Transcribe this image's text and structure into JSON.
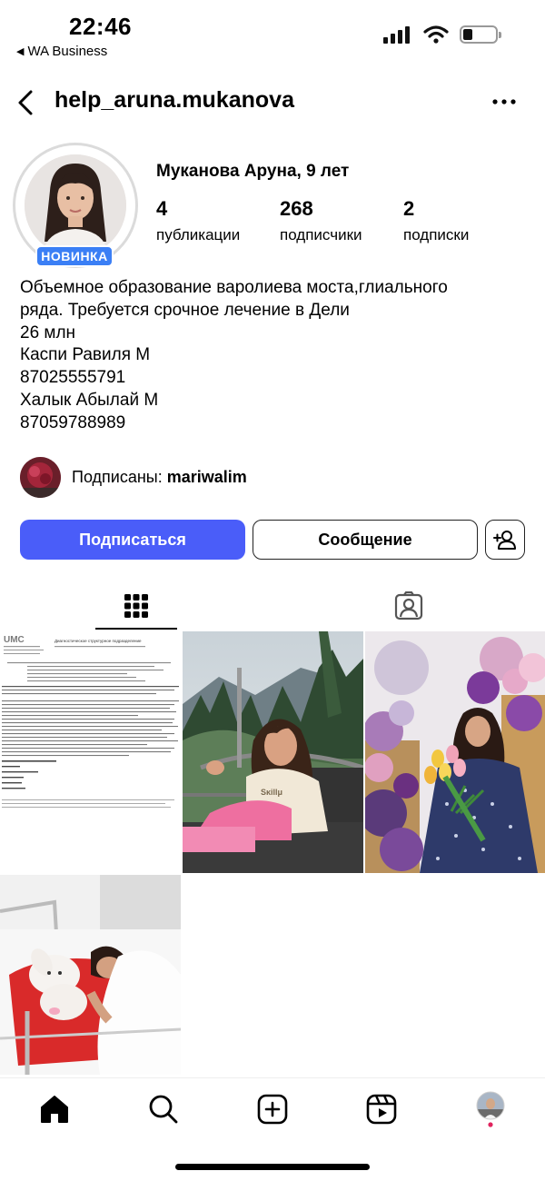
{
  "status_bar": {
    "time": "22:46",
    "back_app": "WA Business"
  },
  "header": {
    "username": "help_aruna.mukanova"
  },
  "profile": {
    "badge": "НОВИНКА",
    "full_name": "Муканова Аруна, 9 лет",
    "stats": [
      {
        "count": "4",
        "label": "публикации"
      },
      {
        "count": "268",
        "label": "подписчики"
      },
      {
        "count": "2",
        "label": "подписки"
      }
    ],
    "bio_lines": [
      "Объемное образование варолиева моста,глиального",
      "ряда. Требуется срочное лечение в Дели",
      "26 млн",
      "Каспи Равиля М",
      "87025555791",
      "Халык Абылай М",
      "87059788989"
    ],
    "followed_by_prefix": "Подписаны: ",
    "followed_by_user": "mariwalim"
  },
  "actions": {
    "follow": "Подписаться",
    "message": "Сообщение"
  },
  "document_preview": {
    "logo": "UMC",
    "title": "Диагностическое структурное подразделение"
  },
  "colors": {
    "follow_button": "#4a5df9",
    "new_badge": "#3b7ff5",
    "notification_dot": "#e0245e"
  }
}
